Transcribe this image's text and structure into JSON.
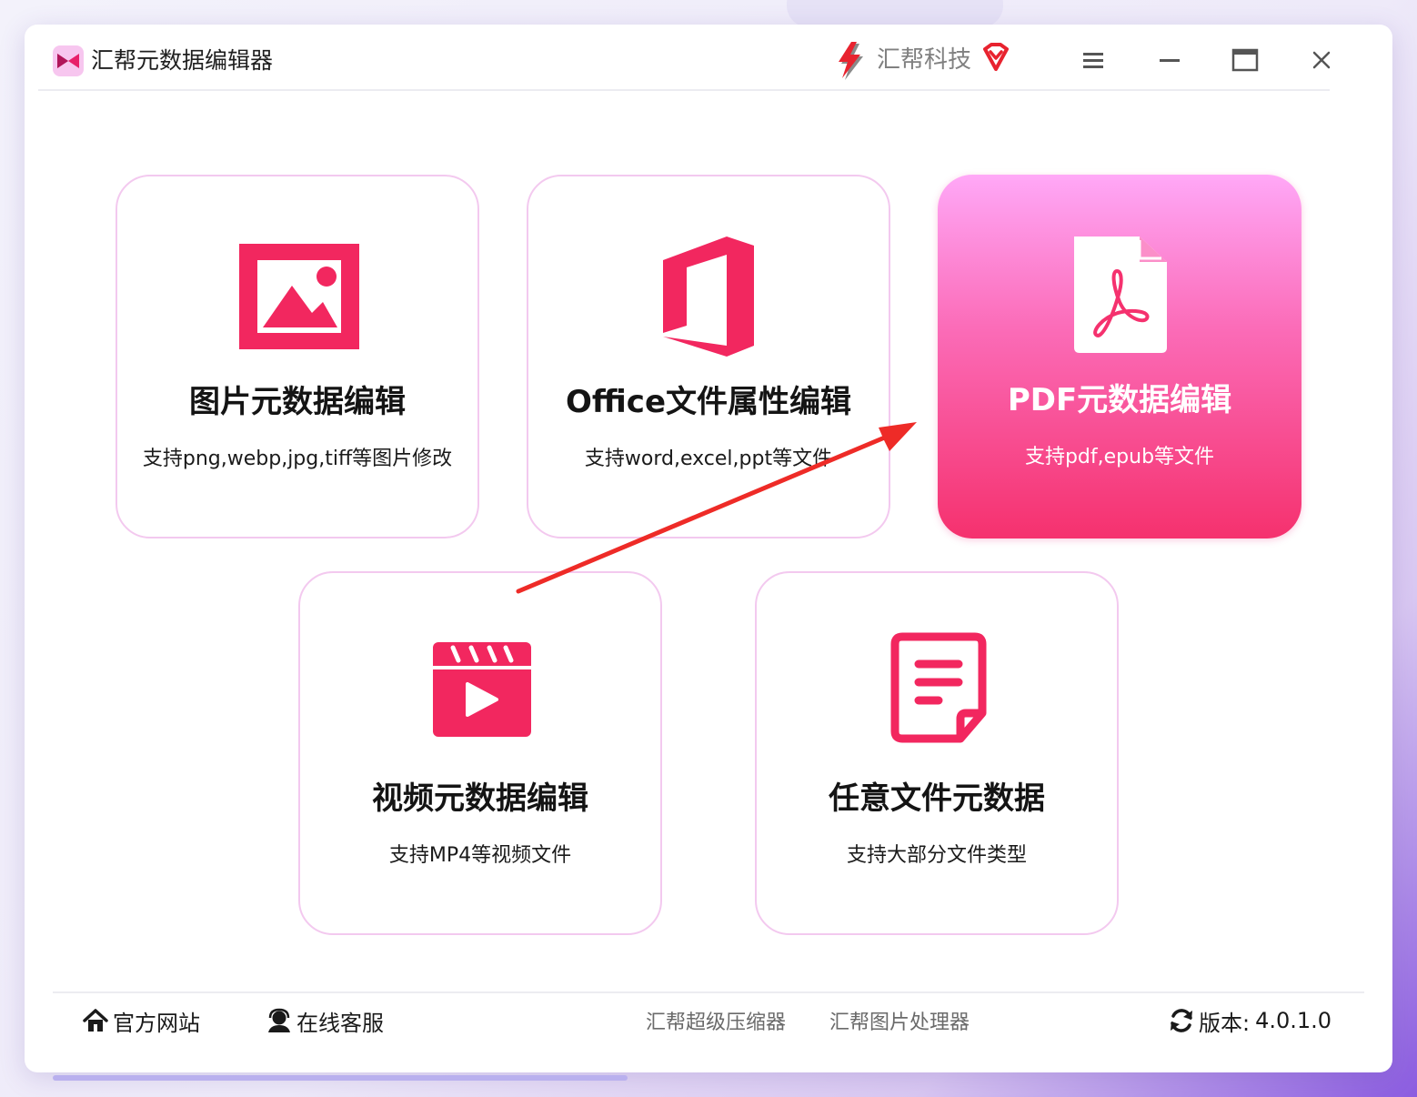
{
  "window": {
    "title": "汇帮元数据编辑器",
    "brand": "汇帮科技"
  },
  "cards": [
    {
      "title": "图片元数据编辑",
      "subtitle": "支持png,webp,jpg,tiff等图片修改",
      "icon": "image-icon"
    },
    {
      "title": "Office文件属性编辑",
      "subtitle": "支持word,excel,ppt等文件",
      "icon": "office-icon"
    },
    {
      "title": "PDF元数据编辑",
      "subtitle": "支持pdf,epub等文件",
      "icon": "pdf-file-icon",
      "selected": true
    },
    {
      "title": "视频元数据编辑",
      "subtitle": "支持MP4等视频文件",
      "icon": "video-clapper-icon"
    },
    {
      "title": "任意文件元数据",
      "subtitle": "支持大部分文件类型",
      "icon": "document-icon"
    }
  ],
  "footer": {
    "website": "官方网站",
    "support": "在线客服",
    "compressor": "汇帮超级压缩器",
    "image_processor": "汇帮图片处理器",
    "version_label": "版本:",
    "version": "4.0.1.0"
  },
  "colors": {
    "accent": "#f5316e",
    "card_border": "#f3c9ef",
    "active_top": "#ffa8f7",
    "active_bottom": "#f5316e"
  }
}
